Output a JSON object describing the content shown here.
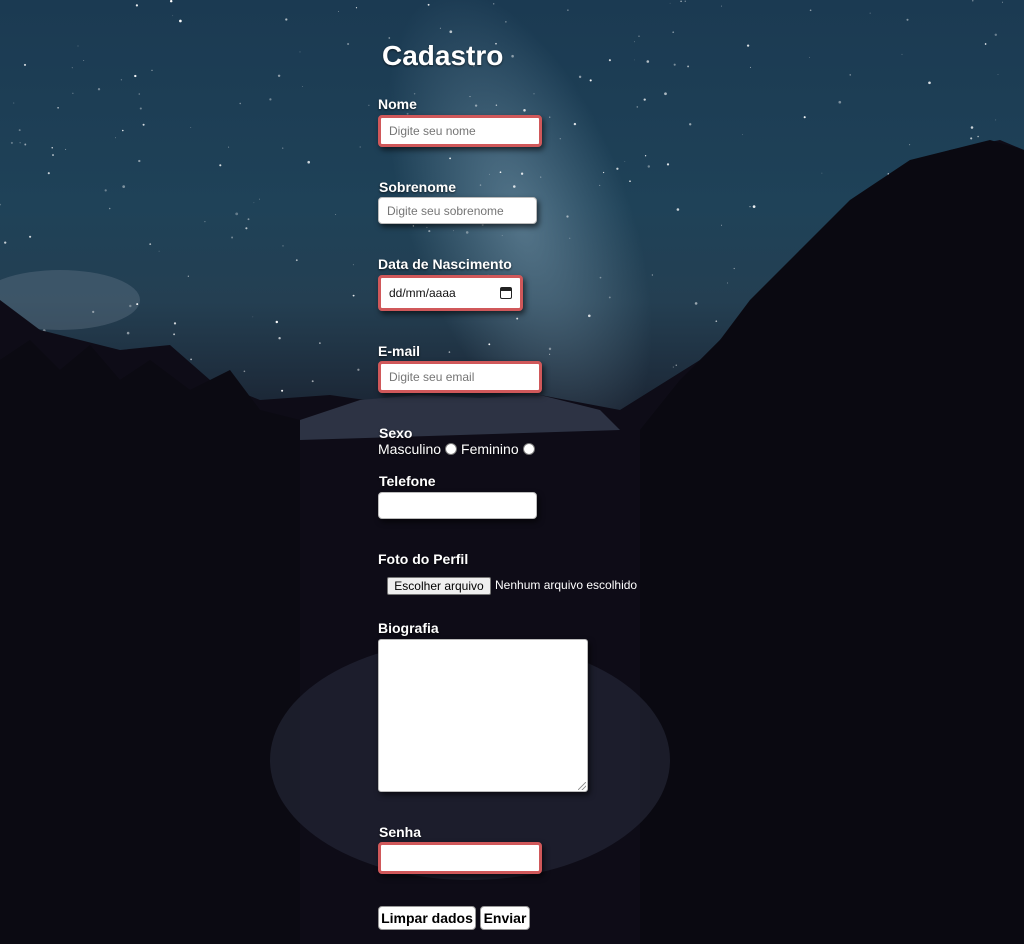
{
  "form": {
    "title": "Cadastro",
    "fields": {
      "nome": {
        "label": "Nome",
        "placeholder": "Digite seu nome"
      },
      "sobrenome": {
        "label": "Sobrenome",
        "placeholder": "Digite seu sobrenome"
      },
      "nascimento": {
        "label": "Data de Nascimento",
        "value": "dd/mm/aaaa"
      },
      "email": {
        "label": "E-mail",
        "placeholder": "Digite seu email"
      },
      "sexo": {
        "label": "Sexo",
        "options": [
          "Masculino",
          "Feminino"
        ]
      },
      "telefone": {
        "label": "Telefone",
        "value": ""
      },
      "foto": {
        "label": "Foto do Perfil",
        "button": "Escolher arquivo",
        "status": "Nenhum arquivo escolhido"
      },
      "biografia": {
        "label": "Biografia",
        "value": ""
      },
      "senha": {
        "label": "Senha",
        "value": ""
      }
    },
    "buttons": {
      "clear": "Limpar dados",
      "submit": "Enviar"
    }
  },
  "colors": {
    "invalid_border": "#d0585a",
    "label_text": "#ffffff",
    "background": "night sky with mountains and lake"
  }
}
